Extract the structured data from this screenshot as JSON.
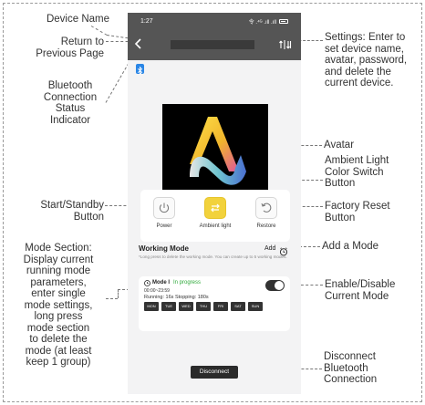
{
  "status_bar": {
    "time": "1:27",
    "signal": "令 .⁴ᴳ .ıll .ıll"
  },
  "title_bar": {
    "back_glyph": "<"
  },
  "annotations": {
    "device_name": "Device Name",
    "return": [
      "Return to",
      "Previous Page"
    ],
    "bluetooth": [
      "Bluetooth",
      "Connection",
      "Status",
      "Indicator"
    ],
    "settings": [
      "Settings: Enter to",
      "set device name,",
      "avatar, password,",
      "and delete the",
      "current device."
    ],
    "avatar": "Avatar",
    "ambient": [
      "Ambient Light",
      "Color Switch",
      "Button"
    ],
    "start_standby": [
      "Start/Standby",
      "Button"
    ],
    "factory_reset": [
      "Factory Reset",
      "Button"
    ],
    "mode_section": [
      "Mode Section:",
      "Display current",
      "running mode",
      "parameters,",
      "enter single",
      "mode settings,",
      "long press",
      "mode section",
      "to delete the",
      "mode (at least",
      "keep 1 group)"
    ],
    "add_mode": "Add a Mode",
    "enable_disable": [
      "Enable/Disable",
      "Current Mode"
    ],
    "disconnect": [
      "Disconnect",
      "Bluetooth",
      "Connection"
    ]
  },
  "controls": {
    "power_label": "Power",
    "ambient_label": "Ambient light",
    "restore_label": "Restore"
  },
  "working_mode": {
    "title": "Working Mode",
    "add_label": "Add",
    "hint": "*Long press to delete the working mode. You can create up to 5 working modes."
  },
  "mode": {
    "name": "Mode I",
    "status": "In progress",
    "time_range": "00:00~23:59",
    "run_info": "Running: 16s  Stopping: 180s",
    "enabled": true,
    "days": [
      "MON",
      "TUE",
      "WED",
      "THU",
      "FRI",
      "SAT",
      "SUN"
    ]
  },
  "disconnect_label": "Disconnect",
  "colors": {
    "title_bar": "#555555",
    "bluetooth": "#2a86e6",
    "ambient_button": "#f2d23c",
    "status_green": "#2eaa3a",
    "dark_button": "#2b2b2b"
  }
}
